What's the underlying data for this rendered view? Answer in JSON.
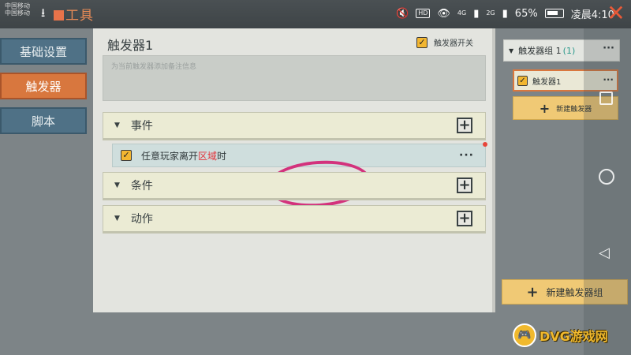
{
  "status_bar": {
    "carrier_line1": "中国移动",
    "carrier_line2": "中国移动",
    "app_title": "工具",
    "hd_badge": "HD",
    "net_line1": "4G",
    "net_line2": "2G",
    "battery": "65%",
    "time": "凌晨4:10"
  },
  "left_nav": {
    "tabs": [
      {
        "label": "基础设置",
        "active": false
      },
      {
        "label": "触发器",
        "active": true
      },
      {
        "label": "脚本",
        "active": false
      }
    ]
  },
  "editor": {
    "title": "触发器1",
    "switch_label": "触发器开关",
    "switch_checked": true,
    "note_placeholder": "为当前触发器添加备注信息",
    "sections": {
      "event": {
        "label": "事件"
      },
      "condition": {
        "label": "条件"
      },
      "action": {
        "label": "动作"
      }
    },
    "event_row": {
      "text_before": "任意玩家离开",
      "text_highlight": "区域",
      "text_after": "时",
      "more": "···"
    }
  },
  "group_panel": {
    "group_name": "触发器组 1",
    "group_count": "(1)",
    "more": "···",
    "trigger_item": "触发器1",
    "new_trigger_label": "新建触发器",
    "new_group_label": "新建触发器组"
  },
  "watermark": {
    "text": "DVG游戏网"
  },
  "colors": {
    "active_tab": "#d8773e",
    "tab": "#4f7186",
    "checkbox": "#f2b631",
    "highlight": "#e2333b",
    "annotation_circle": "#d3327c",
    "button_yellow": "#f0c975"
  }
}
